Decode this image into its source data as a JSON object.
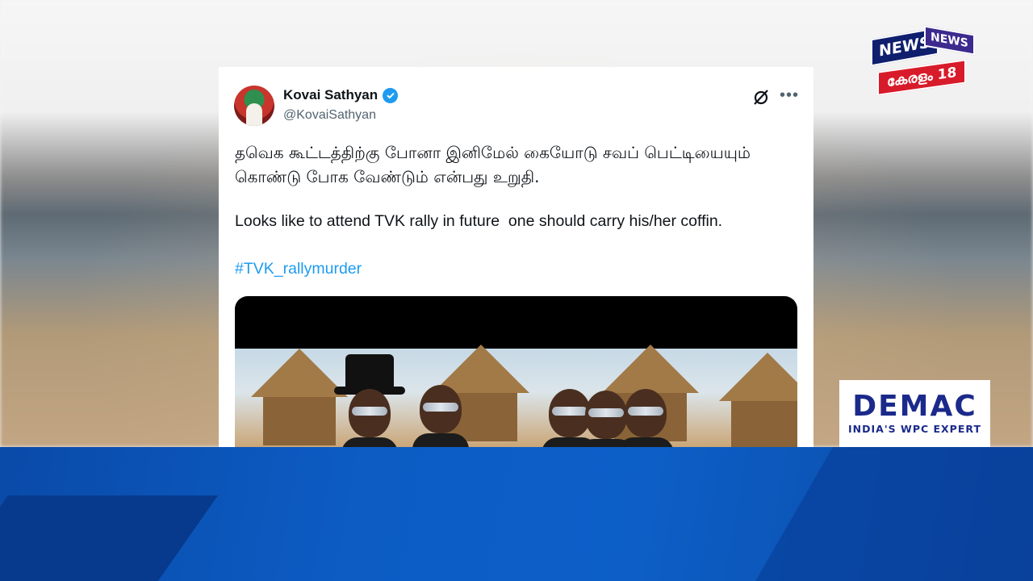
{
  "tweet": {
    "author_name": "Kovai Sathyan",
    "author_handle": "@KovaiSathyan",
    "text_tamil": "தவெக கூட்டத்திற்கு போனா இனிமேல் கையோடு சவப் பெட்டியையும் கொண்டு போக வேண்டும் என்பது உறுதி.",
    "text_english": "Looks like to attend TVK rally in future  one should carry his/her coffin.",
    "hashtag": "#TVK_rallymurder",
    "verified_color": "#1d9bf0",
    "hashtag_color": "#1d9bf0"
  },
  "logos": {
    "channel": {
      "line1": "NEWS",
      "line1b": "NEWS",
      "line2": "കേരളം 18"
    },
    "sponsor": {
      "title": "DEMAC",
      "subtitle": "INDIA'S WPC EXPERT"
    }
  },
  "icons": {
    "verified": "verified-badge-icon",
    "grok": "grok-icon",
    "more": "more-options-icon"
  }
}
